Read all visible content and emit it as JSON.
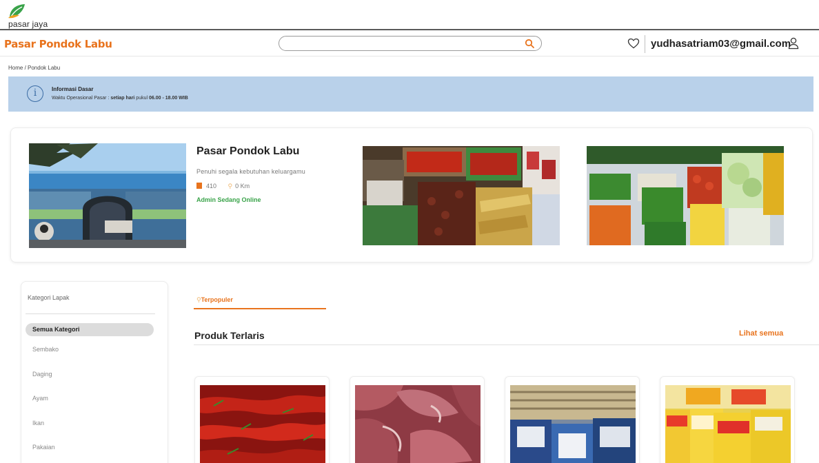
{
  "brand": {
    "logo_text": "pasar jaya"
  },
  "header": {
    "market_name": "Pasar Pondok Labu",
    "search_placeholder": "",
    "user_email": "yudhasatriam03@gmail.com"
  },
  "breadcrumb": "Home / Pondok Labu",
  "info": {
    "title": "Informasi Dasar",
    "text_prefix": "Waktu Operasional Pasar : ",
    "text_bold_1": "setiap hari",
    "text_mid": " pukul ",
    "text_bold_2": "06.00 - 18.00 WIB"
  },
  "market": {
    "name": "Pasar Pondok Labu",
    "tagline": "Penuhi segala kebutuhan keluargamu",
    "stall_count": "410",
    "distance": "0 Km",
    "status": "Admin Sedang Online"
  },
  "sidebar": {
    "heading": "Kategori Lapak",
    "items": [
      {
        "label": "Semua Kategori",
        "active": true
      },
      {
        "label": "Sembako"
      },
      {
        "label": "Daging"
      },
      {
        "label": "Ayam"
      },
      {
        "label": "Ikan"
      },
      {
        "label": "Pakaian"
      }
    ]
  },
  "main": {
    "tab_label": "Terpopuler",
    "section_title": "Produk Terlaris",
    "see_all": "Lihat semua"
  },
  "colors": {
    "accent": "#e8731d",
    "online": "#3aa34a",
    "banner": "#b9d1ea",
    "logo_green": "#3aa34a",
    "logo_orange": "#f0a020"
  }
}
